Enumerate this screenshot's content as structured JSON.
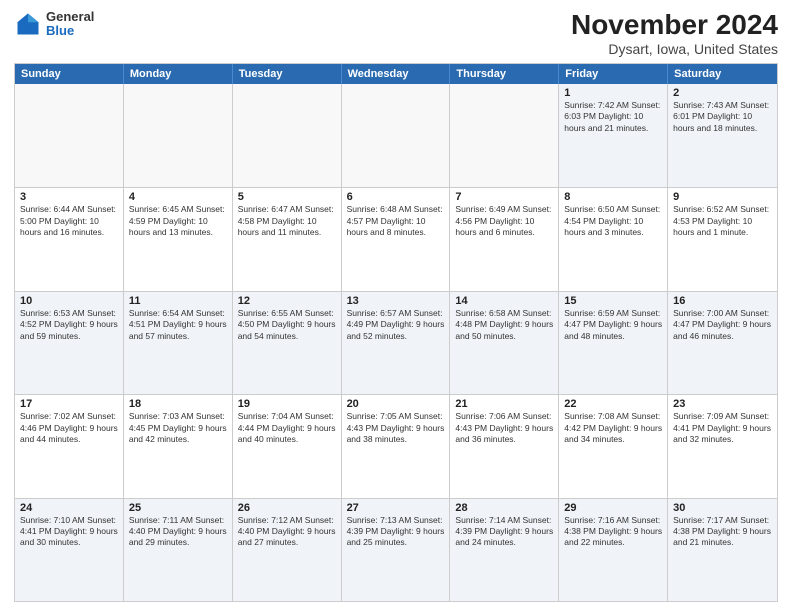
{
  "logo": {
    "general": "General",
    "blue": "Blue"
  },
  "title": "November 2024",
  "subtitle": "Dysart, Iowa, United States",
  "header_days": [
    "Sunday",
    "Monday",
    "Tuesday",
    "Wednesday",
    "Thursday",
    "Friday",
    "Saturday"
  ],
  "weeks": [
    [
      {
        "day": "",
        "info": "",
        "empty": true
      },
      {
        "day": "",
        "info": "",
        "empty": true
      },
      {
        "day": "",
        "info": "",
        "empty": true
      },
      {
        "day": "",
        "info": "",
        "empty": true
      },
      {
        "day": "",
        "info": "",
        "empty": true
      },
      {
        "day": "1",
        "info": "Sunrise: 7:42 AM\nSunset: 6:03 PM\nDaylight: 10 hours\nand 21 minutes.",
        "empty": false
      },
      {
        "day": "2",
        "info": "Sunrise: 7:43 AM\nSunset: 6:01 PM\nDaylight: 10 hours\nand 18 minutes.",
        "empty": false
      }
    ],
    [
      {
        "day": "3",
        "info": "Sunrise: 6:44 AM\nSunset: 5:00 PM\nDaylight: 10 hours\nand 16 minutes.",
        "empty": false
      },
      {
        "day": "4",
        "info": "Sunrise: 6:45 AM\nSunset: 4:59 PM\nDaylight: 10 hours\nand 13 minutes.",
        "empty": false
      },
      {
        "day": "5",
        "info": "Sunrise: 6:47 AM\nSunset: 4:58 PM\nDaylight: 10 hours\nand 11 minutes.",
        "empty": false
      },
      {
        "day": "6",
        "info": "Sunrise: 6:48 AM\nSunset: 4:57 PM\nDaylight: 10 hours\nand 8 minutes.",
        "empty": false
      },
      {
        "day": "7",
        "info": "Sunrise: 6:49 AM\nSunset: 4:56 PM\nDaylight: 10 hours\nand 6 minutes.",
        "empty": false
      },
      {
        "day": "8",
        "info": "Sunrise: 6:50 AM\nSunset: 4:54 PM\nDaylight: 10 hours\nand 3 minutes.",
        "empty": false
      },
      {
        "day": "9",
        "info": "Sunrise: 6:52 AM\nSunset: 4:53 PM\nDaylight: 10 hours\nand 1 minute.",
        "empty": false
      }
    ],
    [
      {
        "day": "10",
        "info": "Sunrise: 6:53 AM\nSunset: 4:52 PM\nDaylight: 9 hours\nand 59 minutes.",
        "empty": false
      },
      {
        "day": "11",
        "info": "Sunrise: 6:54 AM\nSunset: 4:51 PM\nDaylight: 9 hours\nand 57 minutes.",
        "empty": false
      },
      {
        "day": "12",
        "info": "Sunrise: 6:55 AM\nSunset: 4:50 PM\nDaylight: 9 hours\nand 54 minutes.",
        "empty": false
      },
      {
        "day": "13",
        "info": "Sunrise: 6:57 AM\nSunset: 4:49 PM\nDaylight: 9 hours\nand 52 minutes.",
        "empty": false
      },
      {
        "day": "14",
        "info": "Sunrise: 6:58 AM\nSunset: 4:48 PM\nDaylight: 9 hours\nand 50 minutes.",
        "empty": false
      },
      {
        "day": "15",
        "info": "Sunrise: 6:59 AM\nSunset: 4:47 PM\nDaylight: 9 hours\nand 48 minutes.",
        "empty": false
      },
      {
        "day": "16",
        "info": "Sunrise: 7:00 AM\nSunset: 4:47 PM\nDaylight: 9 hours\nand 46 minutes.",
        "empty": false
      }
    ],
    [
      {
        "day": "17",
        "info": "Sunrise: 7:02 AM\nSunset: 4:46 PM\nDaylight: 9 hours\nand 44 minutes.",
        "empty": false
      },
      {
        "day": "18",
        "info": "Sunrise: 7:03 AM\nSunset: 4:45 PM\nDaylight: 9 hours\nand 42 minutes.",
        "empty": false
      },
      {
        "day": "19",
        "info": "Sunrise: 7:04 AM\nSunset: 4:44 PM\nDaylight: 9 hours\nand 40 minutes.",
        "empty": false
      },
      {
        "day": "20",
        "info": "Sunrise: 7:05 AM\nSunset: 4:43 PM\nDaylight: 9 hours\nand 38 minutes.",
        "empty": false
      },
      {
        "day": "21",
        "info": "Sunrise: 7:06 AM\nSunset: 4:43 PM\nDaylight: 9 hours\nand 36 minutes.",
        "empty": false
      },
      {
        "day": "22",
        "info": "Sunrise: 7:08 AM\nSunset: 4:42 PM\nDaylight: 9 hours\nand 34 minutes.",
        "empty": false
      },
      {
        "day": "23",
        "info": "Sunrise: 7:09 AM\nSunset: 4:41 PM\nDaylight: 9 hours\nand 32 minutes.",
        "empty": false
      }
    ],
    [
      {
        "day": "24",
        "info": "Sunrise: 7:10 AM\nSunset: 4:41 PM\nDaylight: 9 hours\nand 30 minutes.",
        "empty": false
      },
      {
        "day": "25",
        "info": "Sunrise: 7:11 AM\nSunset: 4:40 PM\nDaylight: 9 hours\nand 29 minutes.",
        "empty": false
      },
      {
        "day": "26",
        "info": "Sunrise: 7:12 AM\nSunset: 4:40 PM\nDaylight: 9 hours\nand 27 minutes.",
        "empty": false
      },
      {
        "day": "27",
        "info": "Sunrise: 7:13 AM\nSunset: 4:39 PM\nDaylight: 9 hours\nand 25 minutes.",
        "empty": false
      },
      {
        "day": "28",
        "info": "Sunrise: 7:14 AM\nSunset: 4:39 PM\nDaylight: 9 hours\nand 24 minutes.",
        "empty": false
      },
      {
        "day": "29",
        "info": "Sunrise: 7:16 AM\nSunset: 4:38 PM\nDaylight: 9 hours\nand 22 minutes.",
        "empty": false
      },
      {
        "day": "30",
        "info": "Sunrise: 7:17 AM\nSunset: 4:38 PM\nDaylight: 9 hours\nand 21 minutes.",
        "empty": false
      }
    ]
  ]
}
